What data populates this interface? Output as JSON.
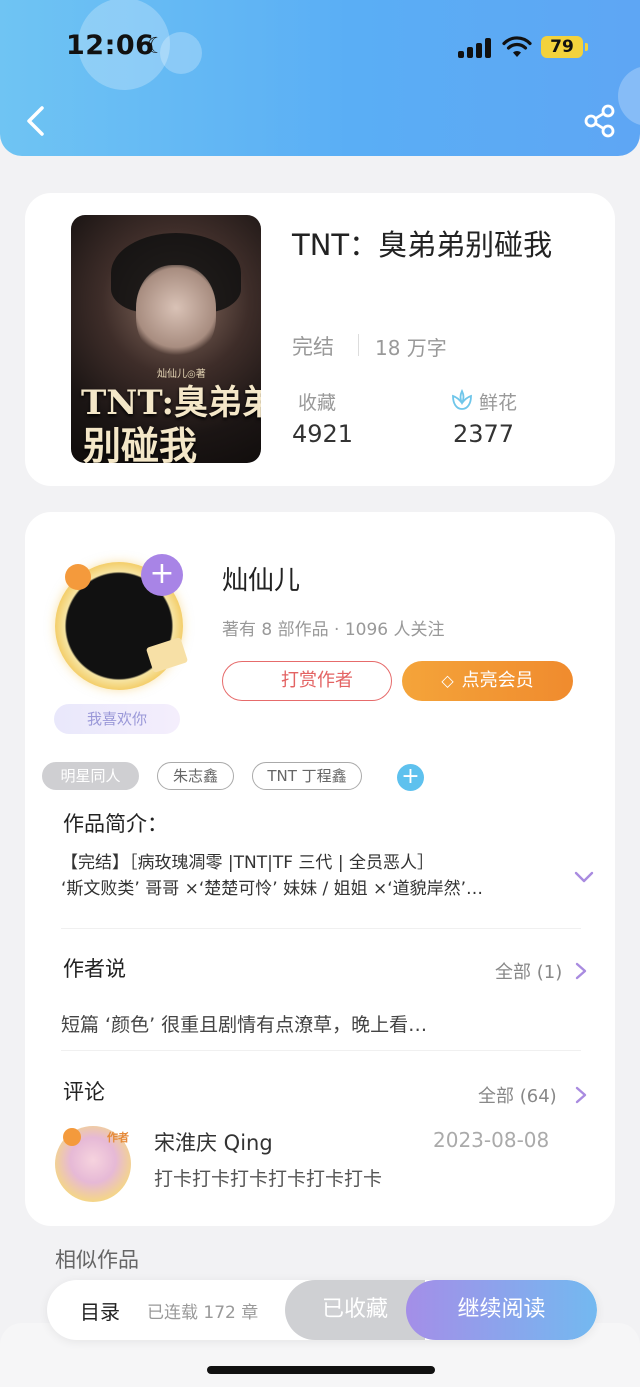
{
  "status_bar": {
    "time": "12:06",
    "battery": "79"
  },
  "header": {
    "back_icon": "chevron-left-icon",
    "share_icon": "share-icon"
  },
  "book": {
    "cover": {
      "author_mark": "灿仙儿◎著",
      "title_line1": "TNT:臭弟弟",
      "title_line2": "别碰我"
    },
    "title": "TNT：臭弟弟别碰我",
    "status": "完结",
    "word_count": "18 万字",
    "favorites_label": "收藏",
    "favorites_value": "4921",
    "flowers_label": "鲜花",
    "flowers_value": "2377"
  },
  "author": {
    "name": "灿仙儿",
    "meta": "著有 8 部作品 · 1096 人关注",
    "like_badge": "我喜欢你",
    "reward_label": "打赏作者",
    "vip_label": "点亮会员"
  },
  "tags": [
    "明星同人",
    "朱志鑫",
    "TNT 丁程鑫"
  ],
  "intro": {
    "title": "作品简介：",
    "line1": "【完结】［病玫瑰凋零 |TNT|TF 三代 | 全员恶人］",
    "line2": "‘斯文败类’ 哥哥 ×‘楚楚可怜’ 妹妹 / 姐姐 ×‘道貌岸然’…"
  },
  "author_says": {
    "title": "作者说",
    "see_all": "全部 (1)",
    "text": "短篇 ‘颜色’ 很重且剧情有点潦草，晚上看…"
  },
  "comments": {
    "title": "评论",
    "see_all": "全部 (64)",
    "items": [
      {
        "author_tag": "作者",
        "name": "宋淮庆 Qing",
        "date": "2023-08-08",
        "text": "打卡打卡打卡打卡打卡打卡"
      }
    ]
  },
  "similar": {
    "title": "相似作品"
  },
  "bottom_bar": {
    "toc": "目录",
    "serial": "已连载 172 章",
    "collected": "已收藏",
    "continue": "继续阅读"
  },
  "colors": {
    "header_start": "#6fc4f3",
    "header_end": "#5ea6f4",
    "accent_purple": "#a884e6",
    "vip_orange": "#f08b2e",
    "reward_red": "#e36363"
  }
}
